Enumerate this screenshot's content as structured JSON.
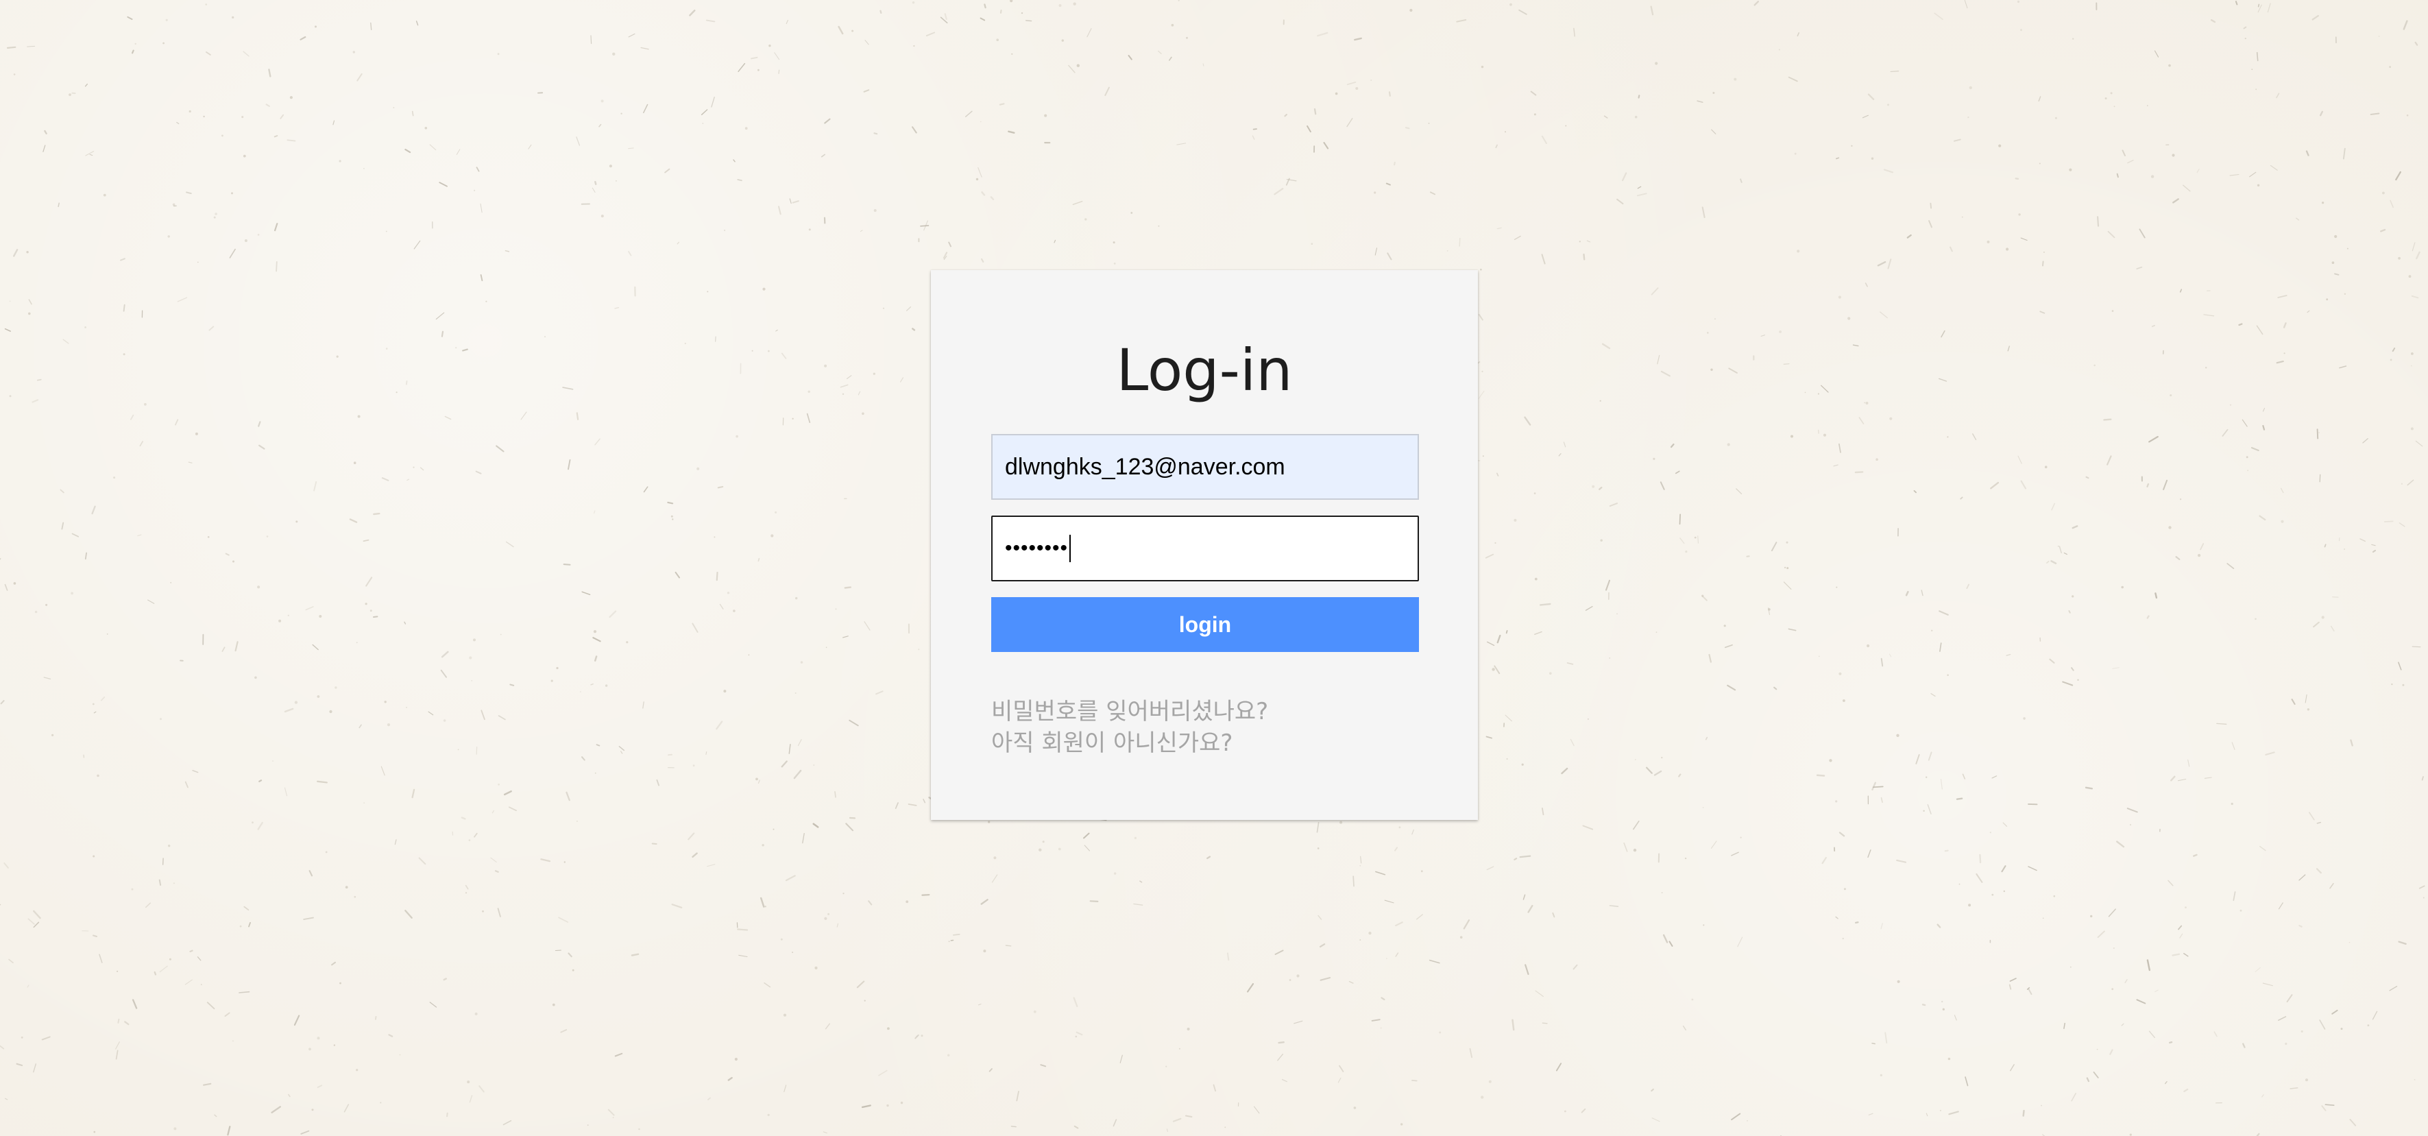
{
  "login_form": {
    "title": "Log-in",
    "email_value": "dlwnghks_123@naver.com",
    "password_mask": "••••••••",
    "login_button_label": "login",
    "forgot_password_link": "비밀번호를 잊어버리셨나요?",
    "signup_link": "아직 회원이 아니신가요?"
  },
  "colors": {
    "background": "#f3eee4",
    "card": "#f5f5f5",
    "button": "#4d90fe",
    "autofill_field": "#e8f0fe",
    "link_text": "#a5a5a5"
  }
}
